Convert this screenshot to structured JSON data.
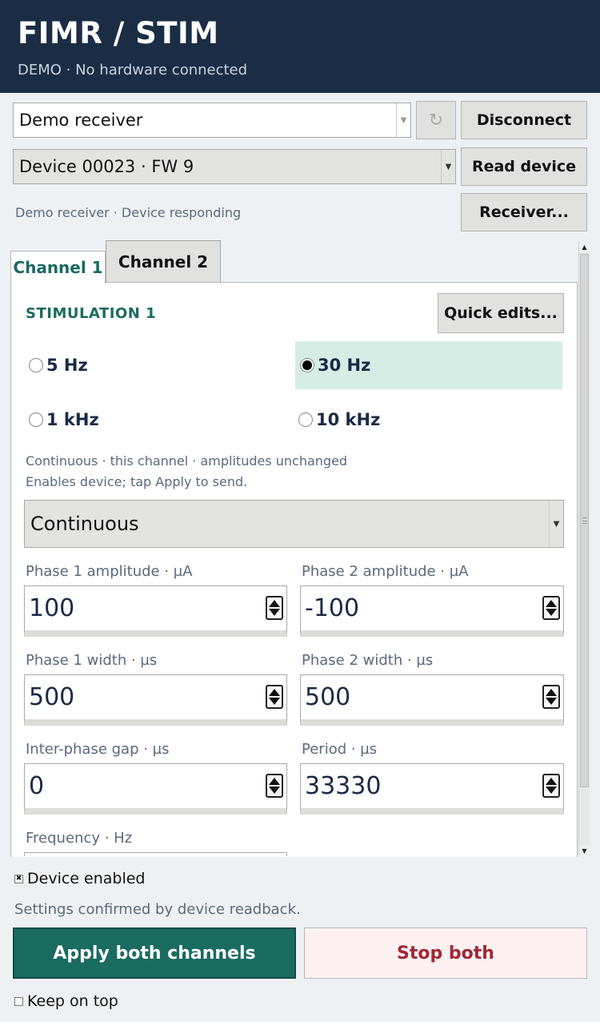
{
  "header": {
    "title": "FIMR  /  STIM",
    "subtitle": "DEMO · No hardware connected"
  },
  "connection": {
    "receiver_select": "Demo receiver",
    "device_select": "Device 00023 · FW 9",
    "status": "Demo receiver · Device responding",
    "disconnect_label": "Disconnect",
    "read_device_label": "Read device",
    "receiver_label": "Receiver..."
  },
  "tabs": [
    {
      "label": "Channel 1",
      "active": true
    },
    {
      "label": "Channel 2",
      "active": false
    }
  ],
  "stimulation": {
    "title": "STIMULATION 1",
    "quick_edits_label": "Quick edits...",
    "presets": [
      {
        "label": "5 Hz",
        "selected": false
      },
      {
        "label": "30 Hz",
        "selected": true
      },
      {
        "label": "1 kHz",
        "selected": false
      },
      {
        "label": "10 kHz",
        "selected": false
      }
    ],
    "hint_line1": "Continuous · this channel · amplitudes unchanged",
    "hint_line2": "Enables device; tap Apply to send.",
    "mode": "Continuous",
    "fields": {
      "phase1_amp": {
        "label": "Phase 1 amplitude · µA",
        "value": "100"
      },
      "phase2_amp": {
        "label": "Phase 2 amplitude · µA",
        "value": "-100"
      },
      "phase1_width": {
        "label": "Phase 1 width · µs",
        "value": "500"
      },
      "phase2_width": {
        "label": "Phase 2 width · µs",
        "value": "500"
      },
      "gap": {
        "label": "Inter-phase gap · µs",
        "value": "0"
      },
      "period": {
        "label": "Period · µs",
        "value": "33330"
      },
      "frequency": {
        "label": "Frequency · Hz"
      }
    }
  },
  "footer": {
    "device_enabled_label": "Device enabled",
    "device_enabled_checked": true,
    "confirm_text": "Settings confirmed by device readback.",
    "apply_label": "Apply both channels",
    "stop_label": "Stop both",
    "keep_on_top_label": "Keep on top",
    "keep_on_top_checked": false,
    "check_mark": "✖"
  },
  "colors": {
    "header_bg": "#1b2d45",
    "accent": "#1a6b60",
    "selected_preset_bg": "#d6ede6",
    "stop_text": "#a22836"
  }
}
